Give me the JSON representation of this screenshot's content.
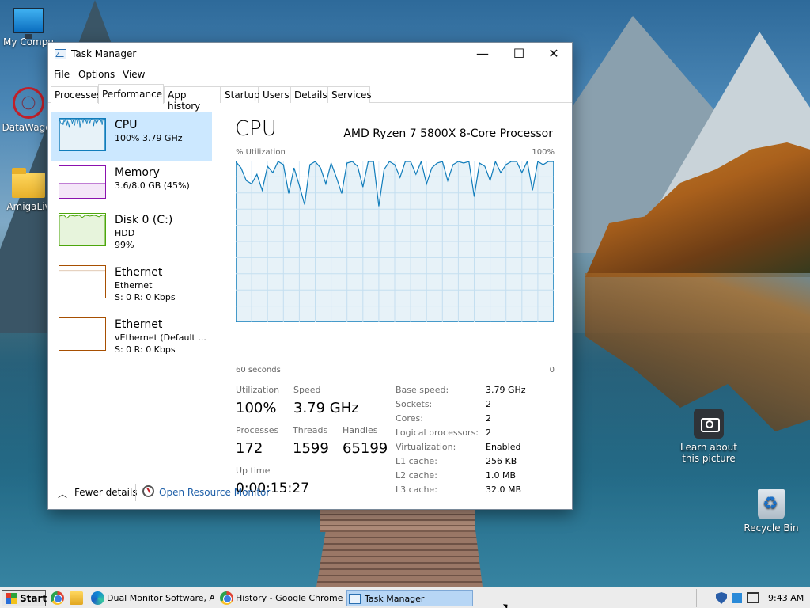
{
  "desktop": {
    "icons": [
      {
        "label": "My Compu",
        "icon": "monitor-icon"
      },
      {
        "label": "DataWagor",
        "icon": "web-app-icon"
      },
      {
        "label": "AmigaLiv",
        "icon": "folder-icon"
      },
      {
        "label": "Learn about this picture",
        "icon": "camera-icon"
      },
      {
        "label": "Recycle Bin",
        "icon": "recycle-bin-icon"
      }
    ]
  },
  "window": {
    "title": "Task Manager",
    "controls": {
      "minimize": "—",
      "maximize": "☐",
      "close": "✕"
    },
    "menu": [
      "File",
      "Options",
      "View"
    ],
    "tabs": [
      "Processes",
      "Performance",
      "App history",
      "Startup",
      "Users",
      "Details",
      "Services"
    ],
    "active_tab": "Performance",
    "sidebar": [
      {
        "name": "CPU",
        "line1": "100%  3.79 GHz",
        "line2": "",
        "color": "#117dbb"
      },
      {
        "name": "Memory",
        "line1": "3.6/8.0 GB (45%)",
        "line2": "",
        "color": "#8b12ae"
      },
      {
        "name": "Disk 0 (C:)",
        "line1": "HDD",
        "line2": "99%",
        "color": "#4da60c"
      },
      {
        "name": "Ethernet",
        "line1": "Ethernet",
        "line2": "S: 0 R: 0 Kbps",
        "color": "#a74f01"
      },
      {
        "name": "Ethernet",
        "line1": "vEthernet (Default ...",
        "line2": "S: 0 R: 0 Kbps",
        "color": "#a74f01"
      }
    ],
    "main": {
      "title": "CPU",
      "processor": "AMD Ryzen 7 5800X 8-Core Processor",
      "graph_top_left": "% Utilization",
      "graph_top_right": "100%",
      "graph_bottom_left": "60 seconds",
      "graph_bottom_right": "0",
      "stats": {
        "utilization_label": "Utilization",
        "utilization": "100%",
        "speed_label": "Speed",
        "speed": "3.79 GHz",
        "processes_label": "Processes",
        "processes": "172",
        "threads_label": "Threads",
        "threads": "1599",
        "handles_label": "Handles",
        "handles": "65199",
        "uptime_label": "Up time",
        "uptime": "0:00:15:27"
      },
      "specs": [
        {
          "key": "Base speed:",
          "value": "3.79 GHz"
        },
        {
          "key": "Sockets:",
          "value": "2"
        },
        {
          "key": "Cores:",
          "value": "2"
        },
        {
          "key": "Logical processors:",
          "value": "2"
        },
        {
          "key": "Virtualization:",
          "value": "Enabled"
        },
        {
          "key": "L1 cache:",
          "value": "256 KB"
        },
        {
          "key": "L2 cache:",
          "value": "1.0 MB"
        },
        {
          "key": "L3 cache:",
          "value": "32.0 MB"
        }
      ]
    },
    "footer": {
      "fewer_details": "Fewer details",
      "resource_monitor": "Open Resource Monitor",
      "chevron": "︿"
    }
  },
  "chart_data": {
    "type": "line",
    "xlabel": "60 seconds",
    "ylabel": "% Utilization",
    "xlim": [
      60,
      0
    ],
    "ylim": [
      0,
      100
    ],
    "grid": true,
    "series": [
      {
        "values": [
          100,
          96,
          88,
          86,
          92,
          82,
          97,
          93,
          100,
          98,
          80,
          96,
          85,
          73,
          98,
          100,
          96,
          86,
          99,
          90,
          80,
          99,
          100,
          97,
          84,
          100,
          100,
          72,
          95,
          100,
          98,
          90,
          100,
          100,
          92,
          100,
          86,
          96,
          99,
          100,
          88,
          98,
          100,
          99,
          100,
          78,
          99,
          97,
          88,
          100,
          93,
          98,
          100,
          100,
          93,
          100,
          82,
          100,
          98,
          100,
          100
        ]
      }
    ],
    "color": "#117dbb"
  },
  "taskbar": {
    "start": "Start",
    "items": [
      {
        "label": "Dual Monitor Software, A...",
        "icon": "edge-icon"
      },
      {
        "label": "History - Google Chrome",
        "icon": "chrome-icon"
      },
      {
        "label": "Task Manager",
        "icon": "task-manager-icon",
        "active": true
      }
    ],
    "time": "9:43 AM"
  }
}
